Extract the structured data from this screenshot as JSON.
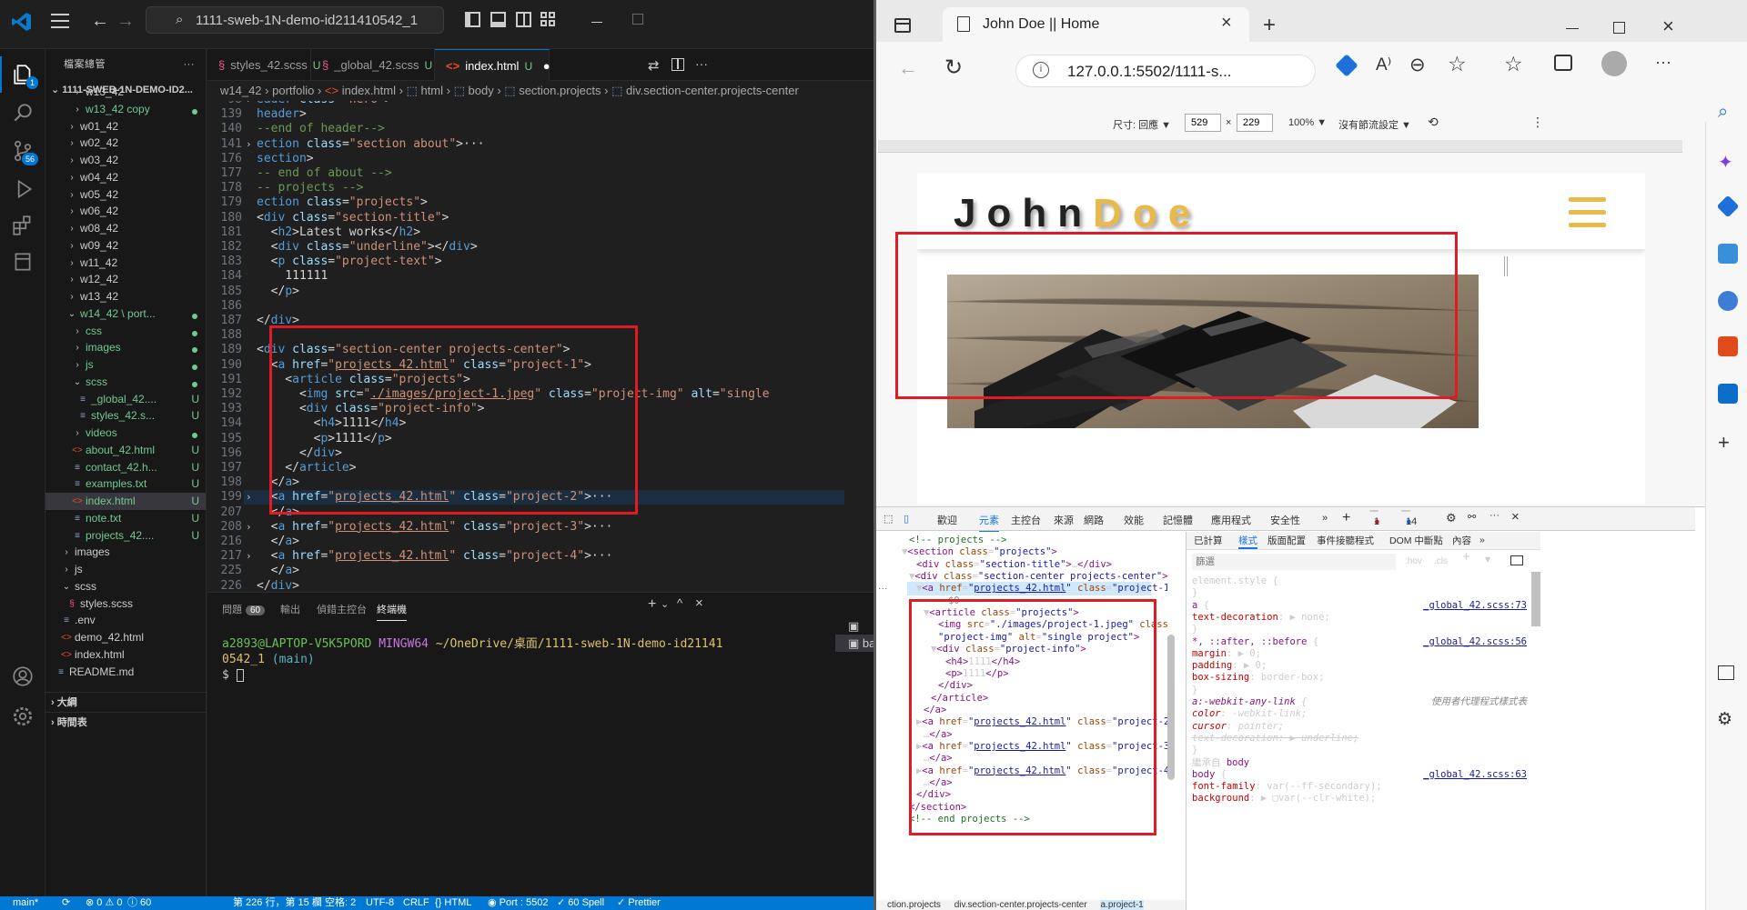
{
  "vscode": {
    "search_text": "1111-sweb-1N-demo-id211410542_1",
    "explorer_title": "檔案總管",
    "explorer_more": "···",
    "root_label": "1111-SWEB-1N-DEMO-ID2...",
    "tree": [
      {
        "label": "w13_42",
        "status": ""
      },
      {
        "label": "w13_42 copy",
        "status": ""
      },
      {
        "label": "w01_42",
        "status": ""
      },
      {
        "label": "w02_42",
        "status": ""
      },
      {
        "label": "w03_42",
        "status": ""
      },
      {
        "label": "w04_42",
        "status": ""
      },
      {
        "label": "w05_42",
        "status": ""
      },
      {
        "label": "w06_42",
        "status": ""
      },
      {
        "label": "w08_42",
        "status": ""
      },
      {
        "label": "w09_42",
        "status": ""
      },
      {
        "label": "w11_42",
        "status": ""
      },
      {
        "label": "w12_42",
        "status": ""
      },
      {
        "label": "w13_42",
        "status": ""
      },
      {
        "label": "w14_42 \\ port...",
        "status": ""
      },
      {
        "label": "css",
        "status": ""
      },
      {
        "label": "images",
        "status": ""
      },
      {
        "label": "js",
        "status": ""
      },
      {
        "label": "scss",
        "status": ""
      },
      {
        "label": "_global_42....",
        "status": "U"
      },
      {
        "label": "styles_42.s...",
        "status": "U"
      },
      {
        "label": "videos",
        "status": ""
      },
      {
        "label": "about_42.html",
        "status": "U"
      },
      {
        "label": "contact_42.h...",
        "status": "U"
      },
      {
        "label": "examples.txt",
        "status": "U"
      },
      {
        "label": "index.html",
        "status": "U"
      },
      {
        "label": "note.txt",
        "status": "U"
      },
      {
        "label": "projects_42....",
        "status": "U"
      },
      {
        "label": "images",
        "status": ""
      },
      {
        "label": "js",
        "status": ""
      },
      {
        "label": "scss",
        "status": ""
      },
      {
        "label": "styles.scss",
        "status": ""
      },
      {
        "label": ".env",
        "status": ""
      },
      {
        "label": "demo_42.html",
        "status": ""
      },
      {
        "label": "index.html",
        "status": ""
      },
      {
        "label": "README.md",
        "status": ""
      }
    ],
    "outline_label": "大綱",
    "timeline_label": "時間表",
    "source_control_badge": "56",
    "explorer_badge": "1",
    "tabs": [
      {
        "label": "styles_42.scss",
        "status": "U"
      },
      {
        "label": "_global_42.scss",
        "status": "U"
      },
      {
        "label": "index.html",
        "status": "U"
      }
    ],
    "breadcrumb": [
      "w14_42",
      "portfolio",
      "index.html",
      "html",
      "body",
      "section.projects",
      "div.section-center.projects-center"
    ],
    "code_lines": [
      {
        "ln": "98",
        "fold": "›",
        "html": "<span class='t-tag'>eader</span> <span class='t-attr'>class</span>=<span class='t-str'>\"hero\"</span>&gt;<span class='t-txt'>···</span>"
      },
      {
        "ln": "139",
        "fold": "",
        "html": "<span class='t-tag'>header</span>&gt;"
      },
      {
        "ln": "140",
        "fold": "",
        "html": "<span class='t-com'>--end of header--&gt;</span>"
      },
      {
        "ln": "141",
        "fold": "›",
        "html": "<span class='t-tag'>ection</span> <span class='t-attr'>class</span>=<span class='t-str'>\"section about\"</span>&gt;<span class='t-txt'>···</span>"
      },
      {
        "ln": "176",
        "fold": "",
        "html": "<span class='t-tag'>section</span>&gt;"
      },
      {
        "ln": "177",
        "fold": "",
        "html": "<span class='t-com'>-- end of about --&gt;</span>"
      },
      {
        "ln": "178",
        "fold": "",
        "html": "<span class='t-com'>-- projects --&gt;</span>"
      },
      {
        "ln": "179",
        "fold": "",
        "html": "<span class='t-tag'>ection</span> <span class='t-attr'>class</span>=<span class='t-str'>\"projects\"</span>&gt;"
      },
      {
        "ln": "180",
        "fold": "",
        "html": "&lt;<span class='t-tag'>div</span> <span class='t-attr'>class</span>=<span class='t-str'>\"section-title\"</span>&gt;"
      },
      {
        "ln": "181",
        "fold": "",
        "html": "  &lt;<span class='t-tag'>h2</span>&gt;Latest works&lt;/<span class='t-tag'>h2</span>&gt;"
      },
      {
        "ln": "182",
        "fold": "",
        "html": "  &lt;<span class='t-tag'>div</span> <span class='t-attr'>class</span>=<span class='t-str'>\"underline\"</span>&gt;&lt;/<span class='t-tag'>div</span>&gt;"
      },
      {
        "ln": "183",
        "fold": "",
        "html": "  &lt;<span class='t-tag'>p</span> <span class='t-attr'>class</span>=<span class='t-str'>\"project-text\"</span>&gt;"
      },
      {
        "ln": "184",
        "fold": "",
        "html": "    111111"
      },
      {
        "ln": "185",
        "fold": "",
        "html": "  &lt;/<span class='t-tag'>p</span>&gt;"
      },
      {
        "ln": "186",
        "fold": "",
        "html": ""
      },
      {
        "ln": "187",
        "fold": "",
        "html": "&lt;/<span class='t-tag'>div</span>&gt;"
      },
      {
        "ln": "188",
        "fold": "",
        "html": ""
      },
      {
        "ln": "189",
        "fold": "",
        "html": "&lt;<span class='t-tag'>div</span> <span class='t-attr'>class</span>=<span class='t-str'>\"section-center projects-center\"</span>&gt;"
      },
      {
        "ln": "190",
        "fold": "",
        "html": "  &lt;<span class='t-tag'>a</span> <span class='t-attr'>href</span>=<span class='t-str'>\"<span class='t-ul'>projects_42.html</span>\"</span> <span class='t-attr'>class</span>=<span class='t-str'>\"project-1\"</span>&gt;"
      },
      {
        "ln": "191",
        "fold": "",
        "html": "    &lt;<span class='t-tag'>article</span> <span class='t-attr'>class</span>=<span class='t-str'>\"projects\"</span>&gt;"
      },
      {
        "ln": "192",
        "fold": "",
        "html": "      &lt;<span class='t-tag'>img</span> <span class='t-attr'>src</span>=<span class='t-str'>\"<span class='t-ul'>./images/project-1.jpeg</span>\"</span> <span class='t-attr'>class</span>=<span class='t-str'>\"project-img\"</span> <span class='t-attr'>alt</span>=<span class='t-str'>\"single</span>"
      },
      {
        "ln": "193",
        "fold": "",
        "html": "      &lt;<span class='t-tag'>div</span> <span class='t-attr'>class</span>=<span class='t-str'>\"project-info\"</span>&gt;"
      },
      {
        "ln": "194",
        "fold": "",
        "html": "        &lt;<span class='t-tag'>h4</span>&gt;1111&lt;/<span class='t-tag'>h4</span>&gt;"
      },
      {
        "ln": "195",
        "fold": "",
        "html": "        &lt;<span class='t-tag'>p</span>&gt;1111&lt;/<span class='t-tag'>p</span>&gt;"
      },
      {
        "ln": "196",
        "fold": "",
        "html": "      &lt;/<span class='t-tag'>div</span>&gt;"
      },
      {
        "ln": "197",
        "fold": "",
        "html": "    &lt;/<span class='t-tag'>article</span>&gt;"
      },
      {
        "ln": "198",
        "fold": "",
        "html": "  &lt;/<span class='t-tag'>a</span>&gt;"
      },
      {
        "ln": "199",
        "fold": "›",
        "html": "  &lt;<span class='t-tag'>a</span> <span class='t-attr'>href</span>=<span class='t-str'>\"<span class='t-ul'>projects_42.html</span>\"</span> <span class='t-attr'>class</span>=<span class='t-str'>\"project-2\"</span>&gt;<span class='t-txt'>···</span>"
      },
      {
        "ln": "207",
        "fold": "",
        "html": "  &lt;/<span class='t-tag'>a</span>&gt;"
      },
      {
        "ln": "208",
        "fold": "›",
        "html": "  &lt;<span class='t-tag'>a</span> <span class='t-attr'>href</span>=<span class='t-str'>\"<span class='t-ul'>projects_42.html</span>\"</span> <span class='t-attr'>class</span>=<span class='t-str'>\"project-3\"</span>&gt;<span class='t-txt'>···</span>"
      },
      {
        "ln": "216",
        "fold": "",
        "html": "  &lt;/<span class='t-tag'>a</span>&gt;"
      },
      {
        "ln": "217",
        "fold": "›",
        "html": "  &lt;<span class='t-tag'>a</span> <span class='t-attr'>href</span>=<span class='t-str'>\"<span class='t-ul'>projects_42.html</span>\"</span> <span class='t-attr'>class</span>=<span class='t-str'>\"project-4\"</span>&gt;<span class='t-txt'>···</span>"
      },
      {
        "ln": "225",
        "fold": "",
        "html": "  &lt;/<span class='t-tag'>a</span>&gt;"
      },
      {
        "ln": "226",
        "fold": "",
        "html": "&lt;/<span class='t-tag'>div</span>&gt;"
      }
    ],
    "panel_tabs": {
      "problems": "問題",
      "problems_count": "60",
      "output": "輸出",
      "debug_console": "偵錯主控台",
      "terminal": "終端機"
    },
    "terminal": {
      "prompt_user": "a2893@LAPTOP-V5K5PORD",
      "prompt_env": "MINGW64",
      "prompt_path": "~/OneDrive/桌面/1111-sweb-1N-demo-id21141",
      "prompt_path2": "0542_1",
      "prompt_branch": "(main)",
      "prompt_symbol": "$"
    },
    "terminal_sessions": [
      "powershell",
      "bash"
    ],
    "status": {
      "branch": "main*",
      "errors": "⊗ 0 ⚠ 0",
      "info": "ⓘ 60",
      "position": "第 226 行，第 15 欄",
      "spaces": "空格: 2",
      "encoding": "UTF-8",
      "eol": "CRLF",
      "language": "{} HTML",
      "port": "◉ Port : 5502",
      "spell": "✓ 60 Spell",
      "prettier": "✓ Prettier"
    }
  },
  "edge": {
    "tab_title": "John Doe || Home",
    "url": "127.0.0.1:5502/1111-s...",
    "device_size_label": "尺寸: 回應 ▼",
    "width": "529",
    "height": "229",
    "times": "×",
    "zoom": "100% ▼",
    "throttle": "沒有節流設定 ▼",
    "site": {
      "logo_first": "John",
      "logo_last": "Doe"
    },
    "devtools_tabs": [
      "歡迎",
      "元素",
      "主控台",
      "來源",
      "網路",
      "效能",
      "記憶體",
      "應用程式",
      "安全性"
    ],
    "error_count": "1",
    "warn_count": "14",
    "elements": [
      {
        "indent": 2,
        "html": "<span class='e-com'>&lt;!-- projects --&gt;</span>"
      },
      {
        "indent": 1,
        "html": "▼<span class='e-tag'>&lt;section</span> <span class='e-attr'>class</span>=<span class='e-val'>\"projects\"</span><span class='e-tag'>&gt;</span>"
      },
      {
        "indent": 3,
        "html": "<span class='e-tag'>&lt;div</span> <span class='e-attr'>class</span>=<span class='e-val'>\"section-title\"</span><span class='e-tag'>&gt;</span>…<span class='e-tag'>&lt;/div&gt;</span>"
      },
      {
        "indent": 2,
        "html": "▼<span class='e-tag'>&lt;div</span> <span class='e-attr'>class</span>=<span class='e-val'>\"section-center projects-center\"</span><span class='e-tag'>&gt;</span>"
      },
      {
        "indent": 3,
        "html": "▼<span class='e-tag'>&lt;a</span> <span class='e-attr'>href</span>=<span class='e-val'>\"<span class='e-ul'>projects_42.html</span>\"</span> <span class='e-attr'>class</span>=<span class='e-val'>\"project-1\"</span><span class='e-tag'>&gt;</span>"
      },
      {
        "indent": 5,
        "html": "<span class='s-grey'>== $0</span>"
      },
      {
        "indent": 4,
        "html": "▼<span class='e-tag'>&lt;article</span> <span class='e-attr'>class</span>=<span class='e-val'>\"projects\"</span><span class='e-tag'>&gt;</span>"
      },
      {
        "indent": 6,
        "html": "<span class='e-tag'>&lt;img</span> <span class='e-attr'>src</span>=<span class='e-val'>\"./images/project-1.jpeg\"</span> <span class='e-attr'>class</span>="
      },
      {
        "indent": 6,
        "html": "<span class='e-val'>\"project-img\"</span> <span class='e-attr'>alt</span>=<span class='e-val'>\"single project\"</span><span class='e-tag'>&gt;</span>"
      },
      {
        "indent": 5,
        "html": "▼<span class='e-tag'>&lt;div</span> <span class='e-attr'>class</span>=<span class='e-val'>\"project-info\"</span><span class='e-tag'>&gt;</span>"
      },
      {
        "indent": 7,
        "html": "<span class='e-tag'>&lt;h4&gt;</span>1111<span class='e-tag'>&lt;/h4&gt;</span>"
      },
      {
        "indent": 7,
        "html": "<span class='e-tag'>&lt;p&gt;</span>1111<span class='e-tag'>&lt;/p&gt;</span>"
      },
      {
        "indent": 6,
        "html": "<span class='e-tag'>&lt;/div&gt;</span>"
      },
      {
        "indent": 5,
        "html": "<span class='e-tag'>&lt;/article&gt;</span>"
      },
      {
        "indent": 4,
        "html": "<span class='e-tag'>&lt;/a&gt;</span>"
      },
      {
        "indent": 3,
        "html": "▶<span class='e-tag'>&lt;a</span> <span class='e-attr'>href</span>=<span class='e-val'>\"<span class='e-ul'>projects_42.html</span>\"</span> <span class='e-attr'>class</span>=<span class='e-val'>\"project-2\"</span><span class='e-tag'>&gt;</span>"
      },
      {
        "indent": 4,
        "html": "…<span class='e-tag'>&lt;/a&gt;</span>"
      },
      {
        "indent": 3,
        "html": "▶<span class='e-tag'>&lt;a</span> <span class='e-attr'>href</span>=<span class='e-val'>\"<span class='e-ul'>projects_42.html</span>\"</span> <span class='e-attr'>class</span>=<span class='e-val'>\"project-3\"</span><span class='e-tag'>&gt;</span>"
      },
      {
        "indent": 4,
        "html": "…<span class='e-tag'>&lt;/a&gt;</span>"
      },
      {
        "indent": 3,
        "html": "▶<span class='e-tag'>&lt;a</span> <span class='e-attr'>href</span>=<span class='e-val'>\"<span class='e-ul'>projects_42.html</span>\"</span> <span class='e-attr'>class</span>=<span class='e-val'>\"project-4\"</span><span class='e-tag'>&gt;</span>"
      },
      {
        "indent": 4,
        "html": "…<span class='e-tag'>&lt;/a&gt;</span>"
      },
      {
        "indent": 3,
        "html": "<span class='e-tag'>&lt;/div&gt;</span>"
      },
      {
        "indent": 2,
        "html": "<span class='e-tag'>&lt;/section&gt;</span>"
      },
      {
        "indent": 2,
        "html": "<span class='e-com'>&lt;!-- end projects --&gt;</span>"
      }
    ],
    "crumbs": [
      "ction.projects",
      "div.section-center.projects-center",
      "a.project-1"
    ],
    "styles_tabs": [
      "已計算",
      "樣式",
      "版面配置",
      "事件接聽程式",
      "DOM 中斷點",
      "內容"
    ],
    "filter_placeholder": "篩選",
    "hov": ":hov",
    "cls": ".cls",
    "style_rules": [
      {
        "html": "element.style {",
        "link": ""
      },
      {
        "html": "}",
        "link": ""
      },
      {
        "html": "<span class='s-sel'>a</span> {",
        "link": "_global_42.scss:73"
      },
      {
        "html": "  <span class='s-prop'>text-decoration</span>: ▶ none;",
        "link": ""
      },
      {
        "html": "}",
        "link": ""
      },
      {
        "html": "<span class='s-sel'>*, ::after, ::before</span> {",
        "link": "_global_42.scss:56"
      },
      {
        "html": "  <span class='s-prop'>margin</span>: ▶ 0;",
        "link": ""
      },
      {
        "html": "  <span class='s-prop'>padding</span>: ▶ 0;",
        "link": ""
      },
      {
        "html": "  <span class='s-prop'>box-sizing</span>: border-box;",
        "link": ""
      },
      {
        "html": "}",
        "link": ""
      },
      {
        "html": "<i><span class='s-sel'>a:-webkit-any-link</span> {</i>",
        "link": "",
        "note": "使用者代理程式樣式表"
      },
      {
        "html": "<i>  <span class='s-prop'>color</span>: -webkit-link;</i>",
        "link": ""
      },
      {
        "html": "<i>  <span class='s-prop'>cursor</span>: pointer;</i>",
        "link": ""
      },
      {
        "html": "<i><s>  text-decoration: ▶ underline;</s></i>",
        "link": ""
      },
      {
        "html": "}",
        "link": ""
      },
      {
        "html": "繼承自 <span class='s-sel'>body</span>",
        "link": ""
      },
      {
        "html": "<span class='s-sel'>body</span> {",
        "link": "_global_42.scss:63"
      },
      {
        "html": "  <span class='s-prop'>font-family</span>: var(--ff-secondary);",
        "link": ""
      },
      {
        "html": "  <span class='s-prop'>background</span>: ▶ □var(--clr-white);",
        "link": ""
      }
    ]
  }
}
